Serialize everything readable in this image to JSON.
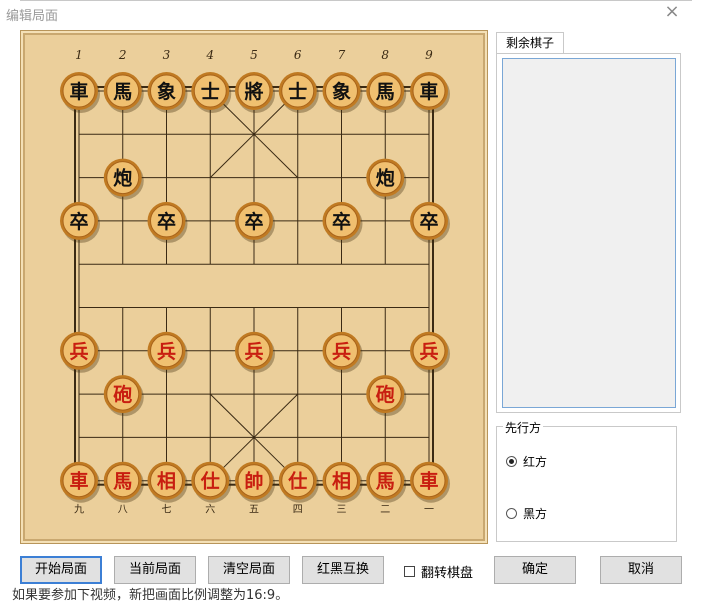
{
  "window": {
    "title": "编辑局面",
    "close_icon": "×"
  },
  "board": {
    "top_numbers": [
      "1",
      "2",
      "3",
      "4",
      "5",
      "6",
      "7",
      "8",
      "9"
    ],
    "bottom_numbers": [
      "九",
      "八",
      "七",
      "六",
      "五",
      "四",
      "三",
      "二",
      "一"
    ],
    "pieces": [
      {
        "char": "車",
        "side": "black",
        "col": 0,
        "row": 0
      },
      {
        "char": "馬",
        "side": "black",
        "col": 1,
        "row": 0
      },
      {
        "char": "象",
        "side": "black",
        "col": 2,
        "row": 0
      },
      {
        "char": "士",
        "side": "black",
        "col": 3,
        "row": 0
      },
      {
        "char": "將",
        "side": "black",
        "col": 4,
        "row": 0
      },
      {
        "char": "士",
        "side": "black",
        "col": 5,
        "row": 0
      },
      {
        "char": "象",
        "side": "black",
        "col": 6,
        "row": 0
      },
      {
        "char": "馬",
        "side": "black",
        "col": 7,
        "row": 0
      },
      {
        "char": "車",
        "side": "black",
        "col": 8,
        "row": 0
      },
      {
        "char": "炮",
        "side": "black",
        "col": 1,
        "row": 2
      },
      {
        "char": "炮",
        "side": "black",
        "col": 7,
        "row": 2
      },
      {
        "char": "卒",
        "side": "black",
        "col": 0,
        "row": 3
      },
      {
        "char": "卒",
        "side": "black",
        "col": 2,
        "row": 3
      },
      {
        "char": "卒",
        "side": "black",
        "col": 4,
        "row": 3
      },
      {
        "char": "卒",
        "side": "black",
        "col": 6,
        "row": 3
      },
      {
        "char": "卒",
        "side": "black",
        "col": 8,
        "row": 3
      },
      {
        "char": "兵",
        "side": "red",
        "col": 0,
        "row": 6
      },
      {
        "char": "兵",
        "side": "red",
        "col": 2,
        "row": 6
      },
      {
        "char": "兵",
        "side": "red",
        "col": 4,
        "row": 6
      },
      {
        "char": "兵",
        "side": "red",
        "col": 6,
        "row": 6
      },
      {
        "char": "兵",
        "side": "red",
        "col": 8,
        "row": 6
      },
      {
        "char": "砲",
        "side": "red",
        "col": 1,
        "row": 7
      },
      {
        "char": "砲",
        "side": "red",
        "col": 7,
        "row": 7
      },
      {
        "char": "車",
        "side": "red",
        "col": 0,
        "row": 9
      },
      {
        "char": "馬",
        "side": "red",
        "col": 1,
        "row": 9
      },
      {
        "char": "相",
        "side": "red",
        "col": 2,
        "row": 9
      },
      {
        "char": "仕",
        "side": "red",
        "col": 3,
        "row": 9
      },
      {
        "char": "帥",
        "side": "red",
        "col": 4,
        "row": 9
      },
      {
        "char": "仕",
        "side": "red",
        "col": 5,
        "row": 9
      },
      {
        "char": "相",
        "side": "red",
        "col": 6,
        "row": 9
      },
      {
        "char": "馬",
        "side": "red",
        "col": 7,
        "row": 9
      },
      {
        "char": "車",
        "side": "red",
        "col": 8,
        "row": 9
      }
    ],
    "colors": {
      "wood": "#ebcf9b",
      "line": "#3a2a14",
      "piece_face": "#f0c070",
      "piece_rim": "#c07a22",
      "black_text": "#111111",
      "red_text": "#c81e10"
    }
  },
  "side_panel": {
    "tab_label": "剩余棋子"
  },
  "first_move": {
    "group_label": "先行方",
    "options": [
      "红方",
      "黑方"
    ],
    "selected": "红方"
  },
  "buttons": {
    "start": "开始局面",
    "current": "当前局面",
    "clear": "清空局面",
    "swap": "红黑互换",
    "flip": "翻转棋盘",
    "ok": "确定",
    "cancel": "取消"
  },
  "background_text": "如果要参加下视频，新把画面比例调整为16:9。"
}
